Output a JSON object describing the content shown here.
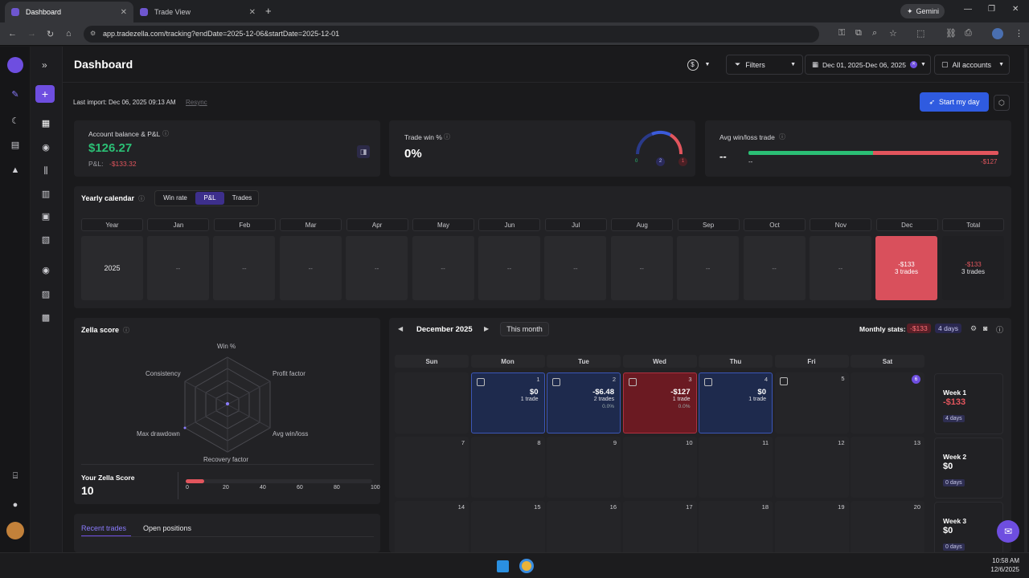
{
  "browser": {
    "tabs": [
      {
        "label": "Dashboard"
      },
      {
        "label": "Trade View"
      }
    ],
    "url": "app.tradezella.com/tracking?endDate=2025-12-06&startDate=2025-12-01",
    "gemini_label": "Gemini"
  },
  "header": {
    "title": "Dashboard",
    "filters_label": "Filters",
    "date_range": "Dec 01, 2025-Dec 06, 2025",
    "accounts_label": "All accounts"
  },
  "import": {
    "text": "Last import: Dec 06, 2025 09:13 AM",
    "resync": "Resync"
  },
  "start_day_label": "Start my day",
  "balance": {
    "label": "Account balance & P&L",
    "value": "$126.27",
    "pnl_label": "P&L:",
    "pnl_value": "-$133.32"
  },
  "trade_win": {
    "label": "Trade win %",
    "value": "0%",
    "win": "0",
    "breakeven": "2",
    "loss": "1"
  },
  "avg_win_loss": {
    "label": "Avg win/loss trade",
    "value": "--",
    "win_value": "--",
    "loss_value": "-$127"
  },
  "yearly": {
    "title": "Yearly calendar",
    "tabs": [
      {
        "label": "Win rate"
      },
      {
        "label": "P&L"
      },
      {
        "label": "Trades"
      }
    ],
    "headers": [
      "Year",
      "Jan",
      "Feb",
      "Mar",
      "Apr",
      "May",
      "Jun",
      "Jul",
      "Aug",
      "Sep",
      "Oct",
      "Nov",
      "Dec",
      "Total"
    ],
    "year": "2025",
    "months": [
      "--",
      "--",
      "--",
      "--",
      "--",
      "--",
      "--",
      "--",
      "--",
      "--",
      "--"
    ],
    "dec": {
      "value": "-$133",
      "trades": "3 trades"
    },
    "total": {
      "value": "-$133",
      "trades": "3 trades"
    }
  },
  "zella": {
    "title": "Zella score",
    "axes": [
      "Win %",
      "Profit factor",
      "Avg win/loss",
      "Recovery factor",
      "Max drawdown",
      "Consistency"
    ],
    "score_label": "Your Zella Score",
    "score": "10",
    "score_fraction": 0.1,
    "scale": [
      "0",
      "20",
      "40",
      "60",
      "80",
      "100"
    ]
  },
  "recent": {
    "tabs": [
      {
        "label": "Recent trades"
      },
      {
        "label": "Open positions"
      }
    ]
  },
  "calendar": {
    "month": "December 2025",
    "this_month": "This month",
    "monthly_stats_label": "Monthly stats:",
    "monthly_pnl": "-$133",
    "monthly_days": "4 days",
    "weekdays": [
      "Sun",
      "Mon",
      "Tue",
      "Wed",
      "Thu",
      "Fri",
      "Sat"
    ],
    "days": [
      {
        "n": "1",
        "pnl": "$0",
        "trades": "1 trade",
        "pct": ""
      },
      {
        "n": "2",
        "pnl": "-$6.48",
        "trades": "2 trades",
        "pct": "0.0%"
      },
      {
        "n": "3",
        "pnl": "-$127",
        "trades": "1 trade",
        "pct": "0.0%"
      },
      {
        "n": "4",
        "pnl": "$0",
        "trades": "1 trade",
        "pct": ""
      },
      {
        "n": "5"
      },
      {
        "n": "6"
      },
      {
        "n": "7"
      },
      {
        "n": "8"
      },
      {
        "n": "9"
      },
      {
        "n": "10"
      },
      {
        "n": "11"
      },
      {
        "n": "12"
      },
      {
        "n": "13"
      },
      {
        "n": "14"
      },
      {
        "n": "15"
      },
      {
        "n": "16"
      },
      {
        "n": "17"
      },
      {
        "n": "18"
      },
      {
        "n": "19"
      },
      {
        "n": "20"
      }
    ],
    "weeks": [
      {
        "label": "Week 1",
        "value": "-$133",
        "days": "4 days"
      },
      {
        "label": "Week 2",
        "value": "$0",
        "days": "0 days"
      },
      {
        "label": "Week 3",
        "value": "$0",
        "days": "0 days"
      }
    ]
  },
  "taskbar": {
    "time": "10:58 AM",
    "date": "12/6/2025"
  },
  "colors": {
    "accent": "#6e4ee0",
    "loss": "#e2555d",
    "profit": "#2bbf75",
    "blue": "#3b5bdb"
  }
}
